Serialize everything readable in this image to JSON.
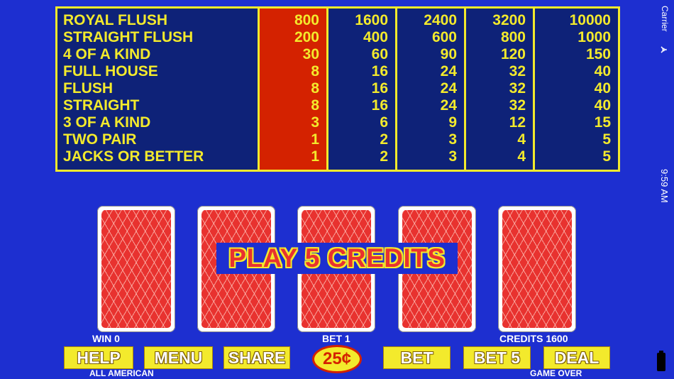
{
  "pay_table": {
    "hands": [
      "ROYAL FLUSH",
      "STRAIGHT FLUSH",
      "4 OF A KIND",
      "FULL HOUSE",
      "FLUSH",
      "STRAIGHT",
      "3 OF A KIND",
      "TWO PAIR",
      "JACKS OR BETTER"
    ],
    "columns": [
      [
        "800",
        "200",
        "30",
        "8",
        "8",
        "8",
        "3",
        "1",
        "1"
      ],
      [
        "1600",
        "400",
        "60",
        "16",
        "16",
        "16",
        "6",
        "2",
        "2"
      ],
      [
        "2400",
        "600",
        "90",
        "24",
        "24",
        "24",
        "9",
        "3",
        "3"
      ],
      [
        "3200",
        "800",
        "120",
        "32",
        "32",
        "32",
        "12",
        "4",
        "4"
      ],
      [
        "10000",
        "1000",
        "150",
        "40",
        "40",
        "40",
        "15",
        "5",
        "5"
      ]
    ],
    "active_column": 1,
    "colors": {
      "border": "#f3ea2c",
      "background": "#0e2278",
      "active": "#d42200"
    }
  },
  "banner": "PLAY 5 CREDITS",
  "status": {
    "win": "WIN 0",
    "bet": "BET 1",
    "credits": "CREDITS 1600",
    "game_name": "ALL AMERICAN",
    "state": "GAME OVER"
  },
  "buttons": {
    "help": "HELP",
    "menu": "MENU",
    "share": "SHARE",
    "coin": "25¢",
    "bet": "BET",
    "bet5": "BET 5",
    "deal": "DEAL"
  },
  "system": {
    "carrier": "Carrier",
    "time": "9:59 AM"
  },
  "icons": {
    "wifi": "wifi-icon",
    "battery": "battery-icon",
    "card_back": "card-back"
  }
}
